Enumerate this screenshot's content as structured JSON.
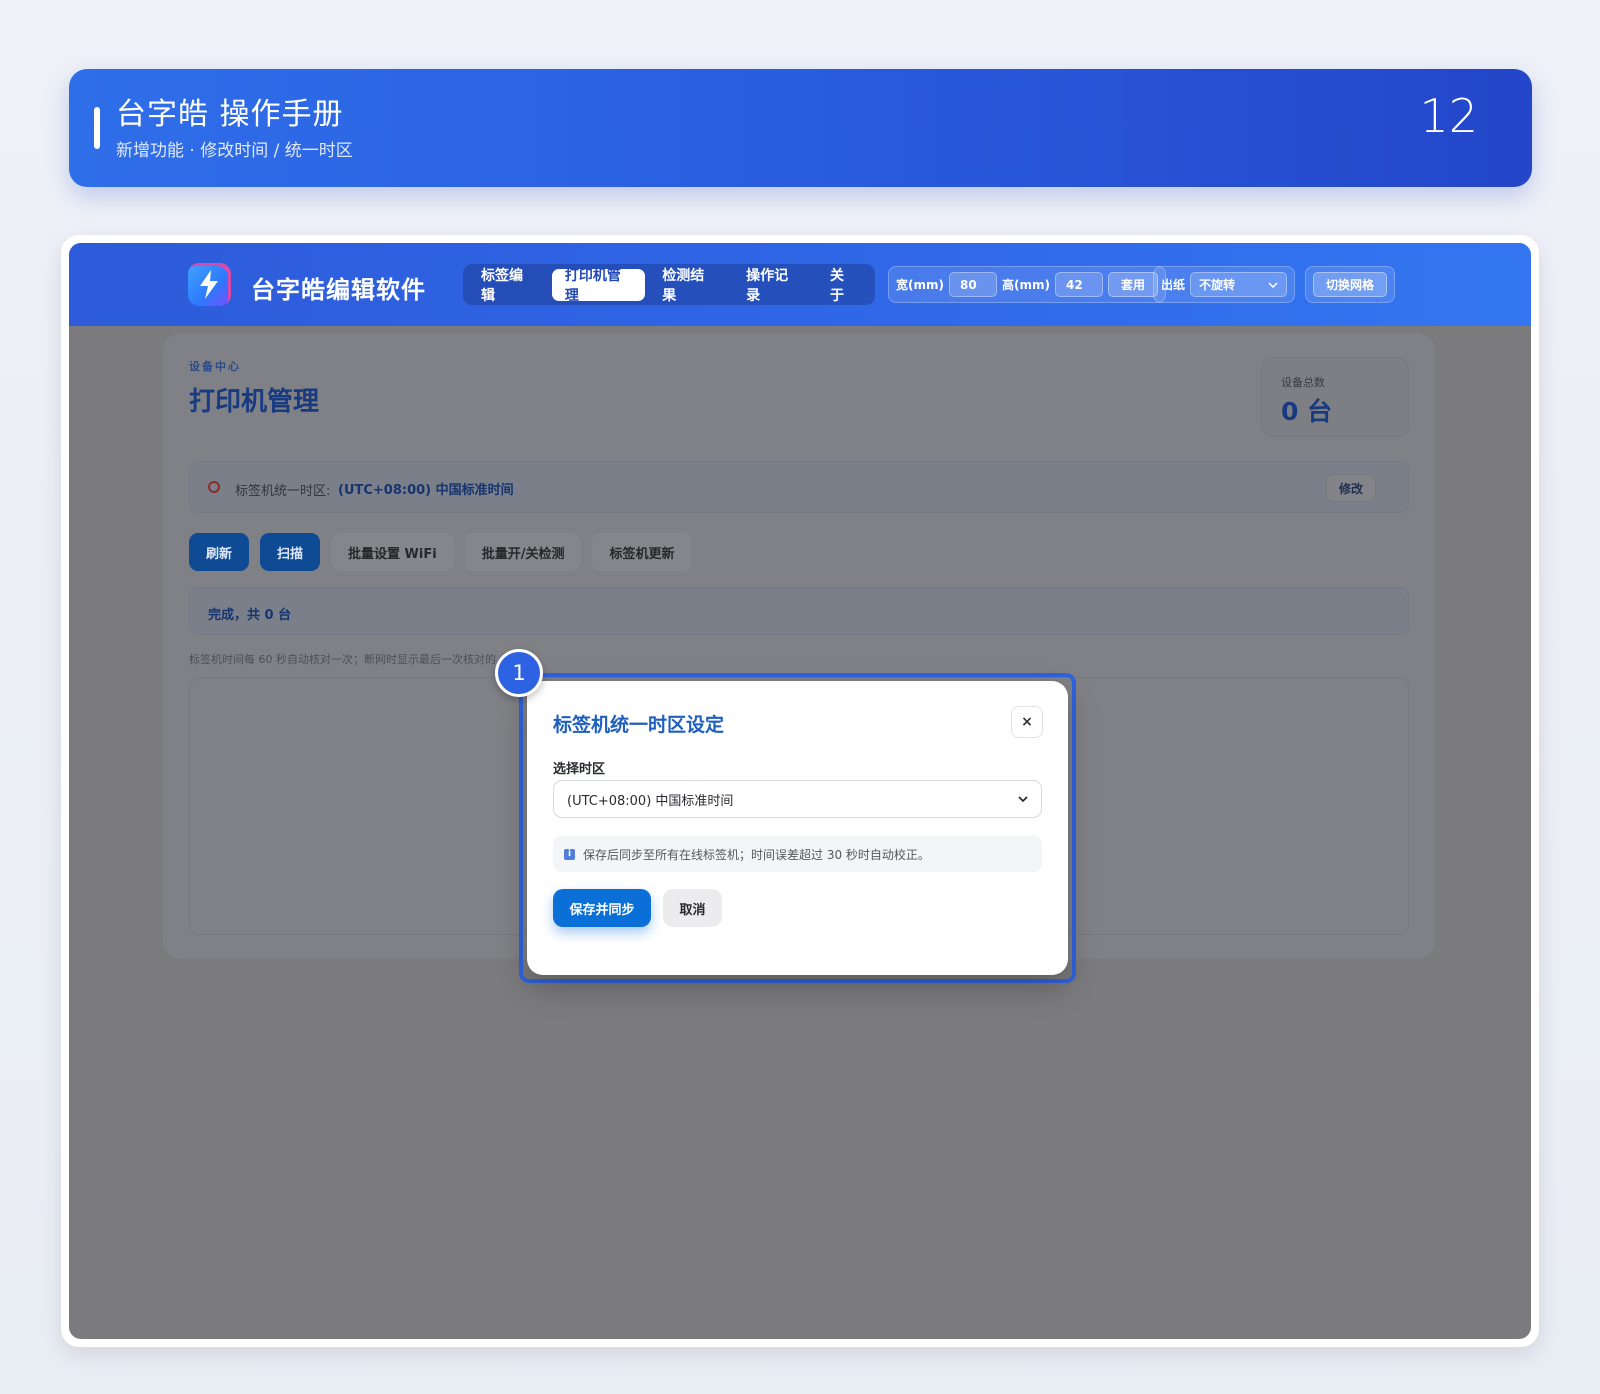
{
  "banner": {
    "title": "台字皓 操作手册",
    "subtitle": "新增功能 · 修改时间 / 统一时区",
    "page_number": "12"
  },
  "app": {
    "name": "台字皓编辑软件",
    "nav_tabs": [
      "标签编辑",
      "打印机管理",
      "检测结果",
      "操作记录",
      "关于"
    ],
    "active_tab": "打印机管理",
    "width_label": "宽(mm)",
    "width_value": "80",
    "height_label": "高(mm)",
    "height_value": "42",
    "apply_label": "套用",
    "paper_label": "出纸",
    "paper_value": "不旋转",
    "grid_toggle_label": "切换网格"
  },
  "page": {
    "eyebrow": "设备中心",
    "title": "打印机管理",
    "stat_label": "设备总数",
    "stat_value": "0 台",
    "tz_label": "标签机统一时区:",
    "tz_value": "(UTC+08:00) 中国标准时间",
    "tz_edit": "修改",
    "actions": [
      "刷新",
      "扫描",
      "批量设置 WiFi",
      "批量开/关检测",
      "标签机更新"
    ],
    "status": "完成，共 0 台",
    "hint": "标签机时间每 60 秒自动核对一次；断网时显示最后一次核对的"
  },
  "modal": {
    "title": "标签机统一时区设定",
    "close": "×",
    "field_label": "选择时区",
    "select_value": "(UTC+08:00) 中国标准时间",
    "info": "保存后同步至所有在线标签机；时间误差超过 30 秒时自动校正。",
    "info_icon": "i",
    "save_button": "保存并同步",
    "cancel_button": "取消"
  },
  "step_badge": "1",
  "colors": {
    "banner_blue": "#2a5fe0",
    "app_bar_blue": "#2f66e6",
    "primary_button": "#0b6fd8",
    "modal_title": "#1f5fbf",
    "overlay_gray": "#7b7b7e"
  }
}
